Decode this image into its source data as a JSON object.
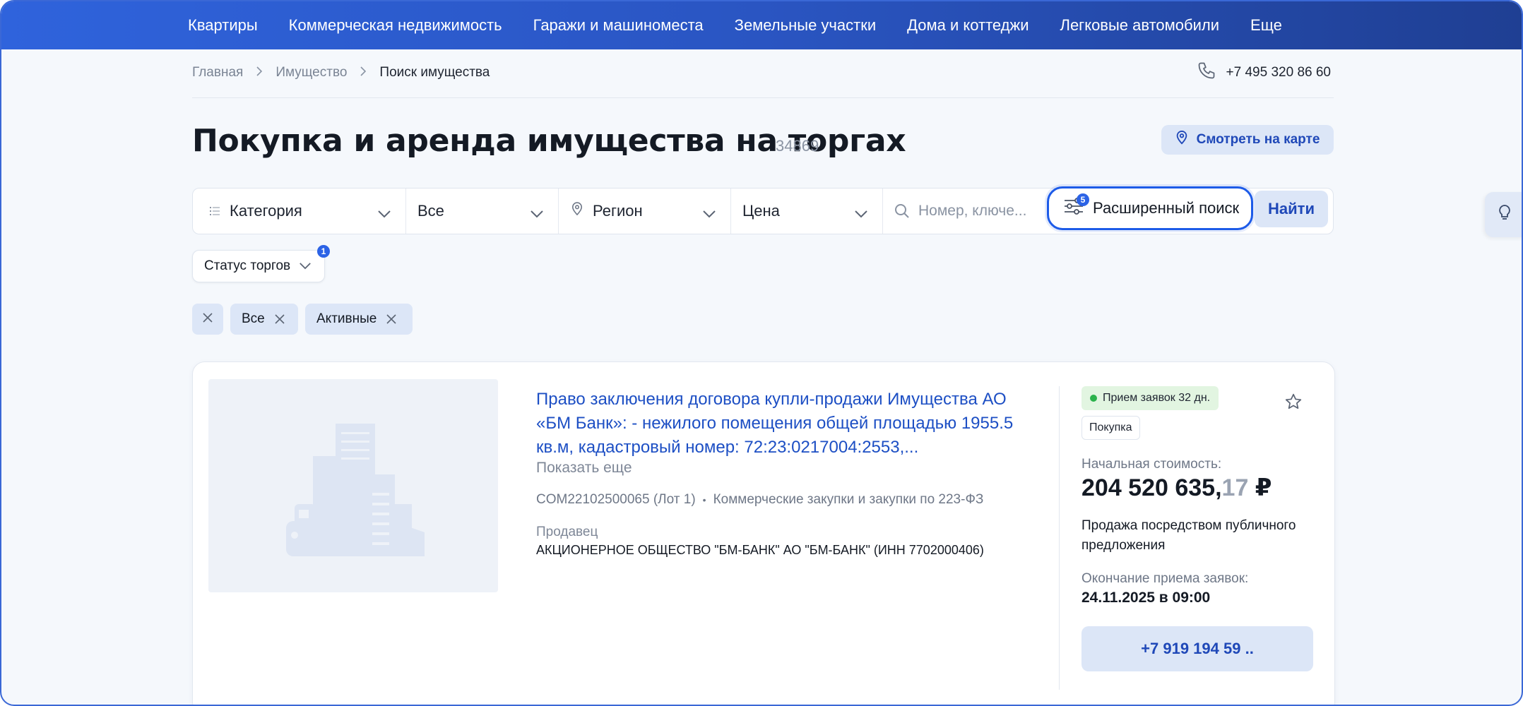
{
  "topnav": {
    "items": [
      "Квартиры",
      "Коммерческая недвижимость",
      "Гаражи и машиноместа",
      "Земельные участки",
      "Дома и коттеджи",
      "Легковые автомобили",
      "Еще"
    ]
  },
  "breadcrumb": {
    "items": [
      "Главная",
      "Имущество",
      "Поиск имущества"
    ]
  },
  "contact": {
    "phone": "+7 495 320 86 60"
  },
  "page": {
    "title": "Покупка и аренда имущества на торгах",
    "count": "34869",
    "map_button": "Смотреть на карте"
  },
  "filters": {
    "category": "Категория",
    "all": "Все",
    "region": "Регион",
    "price": "Цена",
    "search_placeholder": "Номер, ключе...",
    "advanced": "Расширенный поиск",
    "advanced_count": "5",
    "find": "Найти",
    "status": "Статус торгов",
    "status_count": "1"
  },
  "chips": {
    "all": "Все",
    "active": "Активные"
  },
  "lot": {
    "title": "Право заключения договора купли-продажи Имущества АО «БМ Банк»: - нежилого помещения общей площадью 1955.5 кв.м, кадастровый номер: 72:23:0217004:2553,...",
    "show_more": "Показать еще",
    "code": "COM22102500065 (Лот 1)",
    "procurement": "Коммерческие закупки и закупки по 223-ФЗ",
    "seller_label": "Продавец",
    "seller": "АКЦИОНЕРНОЕ ОБЩЕСТВО \"БМ-БАНК\" АО \"БМ-БАНК\" (ИНН 7702000406)",
    "status_badge": "Прием заявок 32 дн.",
    "type_badge": "Покупка",
    "price_label": "Начальная стоимость:",
    "price_main": "204 520 635,",
    "price_kop": "17",
    "currency": " ₽",
    "sale_type": "Продажа посредством публичного предложения",
    "end_label": "Окончание приема заявок:",
    "end_date": "24.11.2025 в 09:00",
    "phone_button": "+7 919 194 59 .."
  },
  "colors": {
    "accent": "#2f63dc",
    "link": "#1d4fc4",
    "chip_bg": "#dce6f7",
    "status_green": "#2bb24c"
  }
}
